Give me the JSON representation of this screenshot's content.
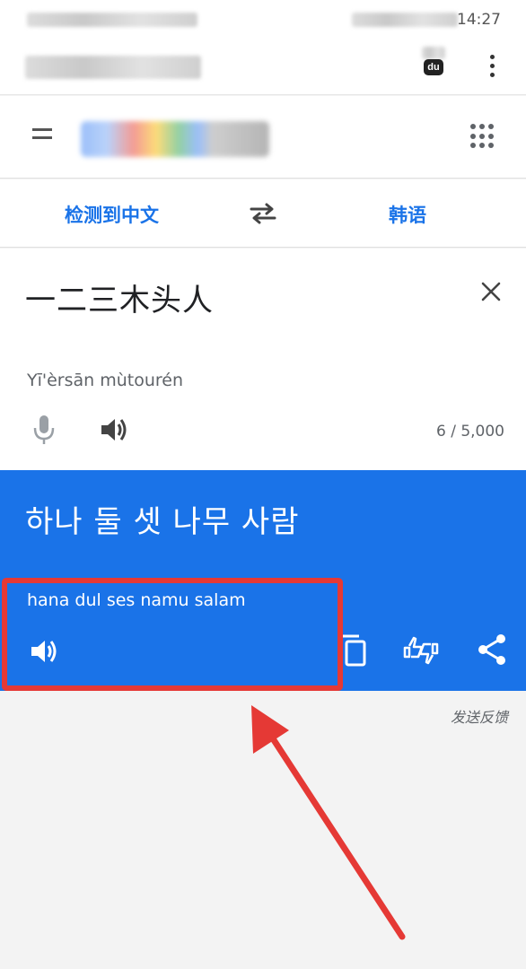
{
  "status_bar": {
    "time": "14:27"
  },
  "browser": {
    "badge": "du",
    "menu_icon": "more-vert-icon"
  },
  "header": {
    "menu_icon": "hamburger-icon",
    "apps_icon": "apps-grid-icon"
  },
  "languages": {
    "source": "检测到中文",
    "target": "韩语",
    "swap_icon": "swap-horiz-icon"
  },
  "input": {
    "text": "一二三木头人",
    "romanization": "Yī'èrsān mùtourén",
    "char_count": "6 / 5,000",
    "clear_icon": "close-icon",
    "mic_icon": "mic-icon",
    "speaker_icon": "volume-up-icon"
  },
  "result": {
    "text": "하나 둘 셋 나무 사람",
    "romanization": "hana dul ses namu salam",
    "speaker_icon": "volume-up-icon",
    "copy_icon": "copy-icon",
    "rate_icon": "thumbs-up-down-icon",
    "share_icon": "share-icon"
  },
  "feedback_label": "发送反馈",
  "colors": {
    "accent": "#1a73e8",
    "annotation": "#e53935",
    "background": "#f3f3f3"
  }
}
